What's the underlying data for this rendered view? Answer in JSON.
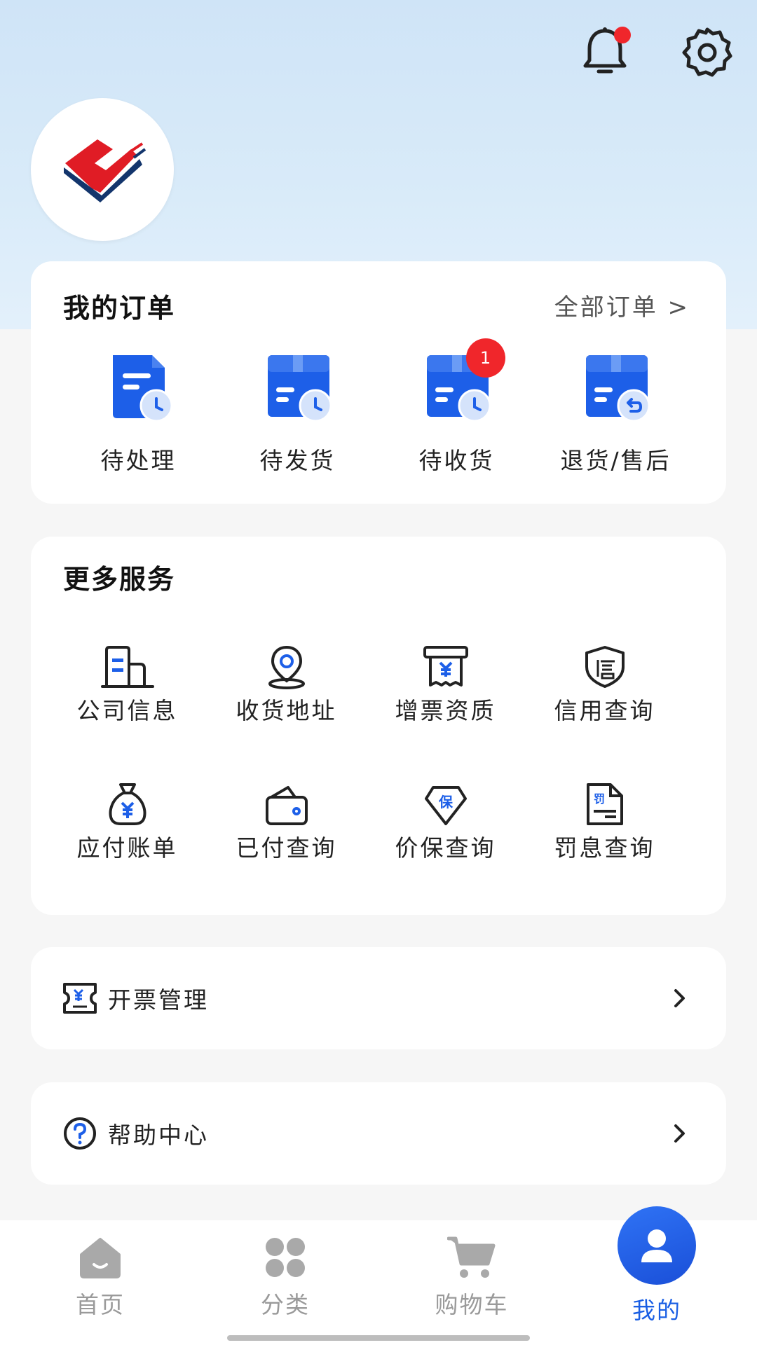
{
  "header": {
    "bell_icon": "bell-icon",
    "settings_icon": "gear-icon",
    "has_notification": true
  },
  "orders": {
    "title": "我的订单",
    "all_link": "全部订单 >",
    "items": [
      {
        "label": "待处理",
        "icon": "document-clock-icon",
        "badge": ""
      },
      {
        "label": "待发货",
        "icon": "box-clock-icon",
        "badge": ""
      },
      {
        "label": "待收货",
        "icon": "box-clock-icon",
        "badge": "1"
      },
      {
        "label": "退货/售后",
        "icon": "box-return-icon",
        "badge": ""
      }
    ]
  },
  "services": {
    "title": "更多服务",
    "items": [
      {
        "label": "公司信息",
        "icon": "building-icon"
      },
      {
        "label": "收货地址",
        "icon": "location-pin-icon"
      },
      {
        "label": "增票资质",
        "icon": "invoice-yuan-icon"
      },
      {
        "label": "信用查询",
        "icon": "shield-credit-icon"
      },
      {
        "label": "应付账单",
        "icon": "money-bag-icon"
      },
      {
        "label": "已付查询",
        "icon": "wallet-icon"
      },
      {
        "label": "价保查询",
        "icon": "price-guarantee-icon"
      },
      {
        "label": "罚息查询",
        "icon": "penalty-doc-icon"
      }
    ]
  },
  "rows": {
    "invoice": {
      "label": "开票管理",
      "icon": "ticket-yuan-icon"
    },
    "help": {
      "label": "帮助中心",
      "icon": "question-circle-icon"
    }
  },
  "tabs": [
    {
      "label": "首页",
      "icon": "home-icon",
      "active": false
    },
    {
      "label": "分类",
      "icon": "category-icon",
      "active": false
    },
    {
      "label": "购物车",
      "icon": "cart-icon",
      "active": false
    },
    {
      "label": "我的",
      "icon": "user-icon",
      "active": true
    }
  ],
  "colors": {
    "accent": "#1a5fe4",
    "badge": "#f0262b",
    "header_bg": "#d9ebf9",
    "tab_inactive": "#9a9a9a"
  }
}
